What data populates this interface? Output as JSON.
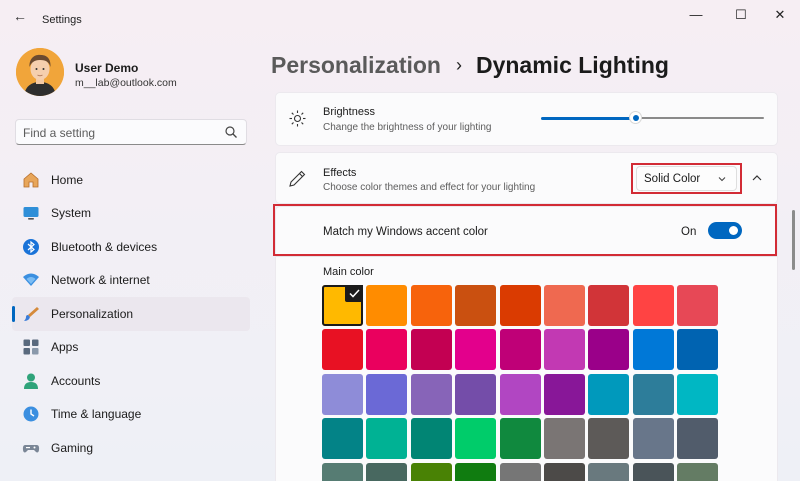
{
  "window": {
    "app_title": "Settings",
    "back_glyph": "←",
    "minimize_glyph": "—",
    "maximize_glyph": "☐",
    "close_glyph": "✕"
  },
  "profile": {
    "name": "User Demo",
    "email": "m__lab@outlook.com"
  },
  "search": {
    "placeholder": "Find a setting",
    "icon": "search-icon"
  },
  "sidebar": {
    "items": [
      {
        "label": "Home",
        "icon": "home-icon",
        "active": false
      },
      {
        "label": "System",
        "icon": "system-icon",
        "active": false
      },
      {
        "label": "Bluetooth & devices",
        "icon": "bluetooth-icon",
        "active": false
      },
      {
        "label": "Network & internet",
        "icon": "network-icon",
        "active": false
      },
      {
        "label": "Personalization",
        "icon": "brush-icon",
        "active": true
      },
      {
        "label": "Apps",
        "icon": "apps-icon",
        "active": false
      },
      {
        "label": "Accounts",
        "icon": "accounts-icon",
        "active": false
      },
      {
        "label": "Time & language",
        "icon": "time-language-icon",
        "active": false
      },
      {
        "label": "Gaming",
        "icon": "gaming-icon",
        "active": false
      }
    ]
  },
  "header": {
    "parent": "Personalization",
    "separator": "›",
    "current": "Dynamic Lighting"
  },
  "brightness": {
    "title": "Brightness",
    "description": "Change the brightness of your lighting",
    "icon": "brightness-icon",
    "value_fraction": 0.43
  },
  "effects": {
    "title": "Effects",
    "description": "Choose color themes and effect for your lighting",
    "icon": "pen-icon",
    "dropdown_value": "Solid Color",
    "expanded": true
  },
  "accent": {
    "title": "Match my Windows accent color",
    "state_label": "On",
    "enabled": true
  },
  "main_color": {
    "label": "Main color",
    "selected_index": 0,
    "swatches": [
      "#ffb900",
      "#ff8c00",
      "#f7630c",
      "#ca5010",
      "#da3b01",
      "#ef6950",
      "#d13438",
      "#ff4343",
      "#e74856",
      "#e81123",
      "#ea005e",
      "#c30052",
      "#e3008c",
      "#bf0077",
      "#c239b3",
      "#9a0089",
      "#0078d7",
      "#0063b1",
      "#8e8cd8",
      "#6b69d6",
      "#8764b8",
      "#744da9",
      "#b146c2",
      "#881798",
      "#0099bc",
      "#2d7d9a",
      "#00b7c3",
      "#038387",
      "#00b294",
      "#018574",
      "#00cc6a",
      "#10893e",
      "#7a7574",
      "#5d5a58",
      "#68768a",
      "#515c6b",
      "#567c73",
      "#486860",
      "#498205",
      "#107c10",
      "#767676",
      "#4c4a48",
      "#69797e",
      "#4a5459",
      "#647c64"
    ]
  },
  "colors": {
    "accent": "#0067c0",
    "highlight_box": "#d22b35"
  }
}
